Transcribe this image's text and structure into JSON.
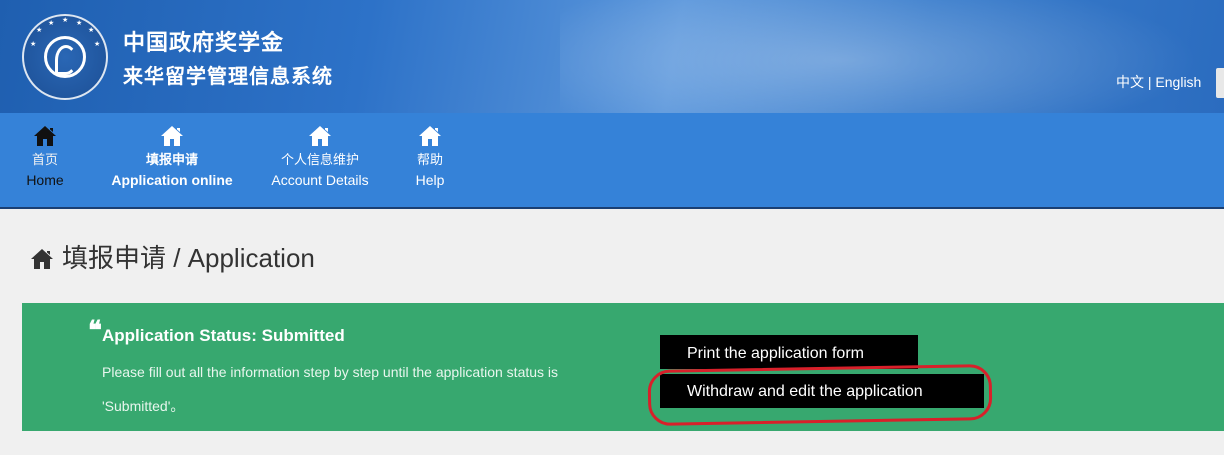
{
  "header": {
    "title": "中国政府奖学金",
    "subtitle": "来华留学管理信息系统",
    "lang_zh": "中文",
    "lang_sep": " | ",
    "lang_en": "English",
    "logo_icon": "china-scholarship-council-seal"
  },
  "nav": {
    "items": [
      {
        "icon": "home-icon",
        "zh": "首页",
        "en": "Home"
      },
      {
        "icon": "home-icon",
        "zh": "填报申请",
        "en": "Application online"
      },
      {
        "icon": "home-icon",
        "zh": "个人信息维护",
        "en": "Account Details"
      },
      {
        "icon": "home-icon",
        "zh": "帮助",
        "en": "Help"
      }
    ]
  },
  "page": {
    "title": "填报申请 / Application"
  },
  "status": {
    "quote": "❝",
    "title": "Application Status: Submitted",
    "description": "Please fill out all the information step by step until the application status is 'Submitted'。",
    "print_button": "Print the application form",
    "withdraw_button": "Withdraw and edit the application"
  },
  "colors": {
    "banner": "#2d72c8",
    "nav": "#3582d8",
    "status_panel": "#37a86f",
    "button": "#000000",
    "highlight_circle": "#d8202a"
  }
}
